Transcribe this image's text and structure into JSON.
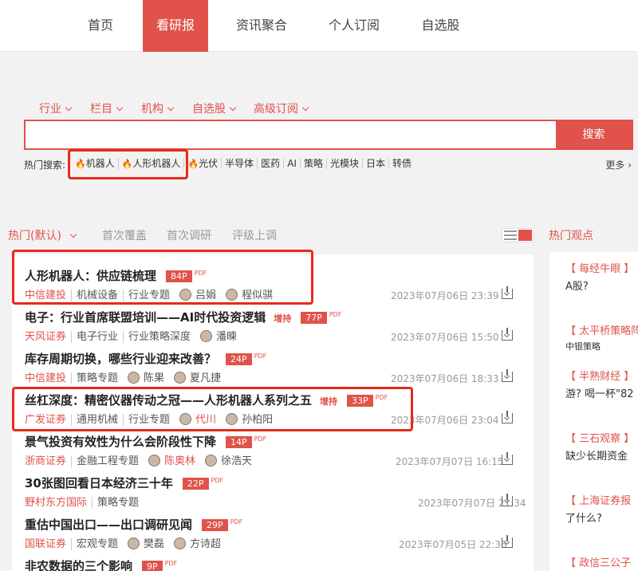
{
  "nav": {
    "items": [
      "首页",
      "看研报",
      "资讯聚合",
      "个人订阅",
      "自选股"
    ],
    "active_index": 1
  },
  "filters": [
    "行业",
    "栏目",
    "机构",
    "自选股",
    "高级订阅"
  ],
  "search": {
    "value": "",
    "placeholder": "",
    "button": "搜索"
  },
  "hot_search": {
    "label": "热门搜索:",
    "tags": [
      "机器人",
      "人形机器人",
      "光伏",
      "半导体",
      "医药",
      "AI",
      "策略",
      "光模块",
      "日本",
      "转债"
    ],
    "more": "更多"
  },
  "sort": {
    "options": [
      "热门(默认)",
      "首次覆盖",
      "首次调研",
      "评级上调"
    ],
    "active": 0
  },
  "reports": [
    {
      "title": "人形机器人：供应链梳理",
      "rating": "",
      "pages": "84P",
      "pdf": "PDF",
      "broker": "中信建投",
      "tags": [
        "机械设备",
        "行业专题"
      ],
      "authors": [
        "吕娟",
        "程似骐"
      ],
      "date": "2023年07月06日 23:39"
    },
    {
      "title": "电子：行业首席联盟培训——AI时代投资逻辑",
      "rating": "增持",
      "pages": "77P",
      "pdf": "PDF",
      "broker": "天风证券",
      "tags": [
        "电子行业",
        "行业策略深度"
      ],
      "authors": [
        "潘暕"
      ],
      "date": "2023年07月06日 15:50"
    },
    {
      "title": "库存周期切换，哪些行业迎来改善？",
      "rating": "",
      "pages": "24P",
      "pdf": "PDF",
      "broker": "中信建投",
      "tags": [
        "策略专题"
      ],
      "authors": [
        "陈果",
        "夏凡捷"
      ],
      "date": "2023年07月06日 18:33"
    },
    {
      "title": "丝杠深度：精密仪器传动之冠——人形机器人系列之五",
      "rating": "增持",
      "pages": "33P",
      "pdf": "PDF",
      "broker": "广发证券",
      "tags": [
        "通用机械",
        "行业专题"
      ],
      "authors": [
        "代川",
        "孙柏阳"
      ],
      "date": "2023年07月06日 23:04"
    },
    {
      "title": "景气投资有效性为什么会阶段性下降",
      "rating": "",
      "pages": "14P",
      "pdf": "PDF",
      "broker": "浙商证券",
      "tags": [
        "金融工程专题"
      ],
      "authors": [
        "陈奥林",
        "徐浩天"
      ],
      "date": "2023年07月07日 16:15"
    },
    {
      "title": "30张图回看日本经济三十年",
      "rating": "",
      "pages": "22P",
      "pdf": "PDF",
      "broker": "野村东方国际",
      "tags": [
        "策略专题"
      ],
      "authors": [],
      "date": "2023年07月07日 21:34"
    },
    {
      "title": "重估中国出口——出口调研见闻",
      "rating": "",
      "pages": "29P",
      "pdf": "PDF",
      "broker": "国联证券",
      "tags": [
        "宏观专题"
      ],
      "authors": [
        "樊磊",
        "方诗超"
      ],
      "date": "2023年07月05日 22:36"
    },
    {
      "title": "非农数据的三个影响",
      "rating": "",
      "pages": "9P",
      "pdf": "PDF",
      "broker": "",
      "tags": [],
      "authors": [],
      "date": ""
    }
  ],
  "sidebar": {
    "title": "热门观点",
    "items": [
      {
        "source": "【 每经牛眼 】",
        "text": "A股?"
      },
      {
        "source": "【 太平桥策略阵",
        "text": "中银策略"
      },
      {
        "source": "【 半熟财经 】",
        "text": "游? 喝一杯\"82"
      },
      {
        "source": "【 三石观察 】",
        "text": "缺少长期资金"
      },
      {
        "source": "【 上海证券报",
        "text": "了什么?"
      },
      {
        "source": "【 政信三公子",
        "text": ""
      }
    ]
  },
  "colors": {
    "accent": "#e0524a",
    "highlight": "#e8291e",
    "background": "#f2f2f2"
  }
}
